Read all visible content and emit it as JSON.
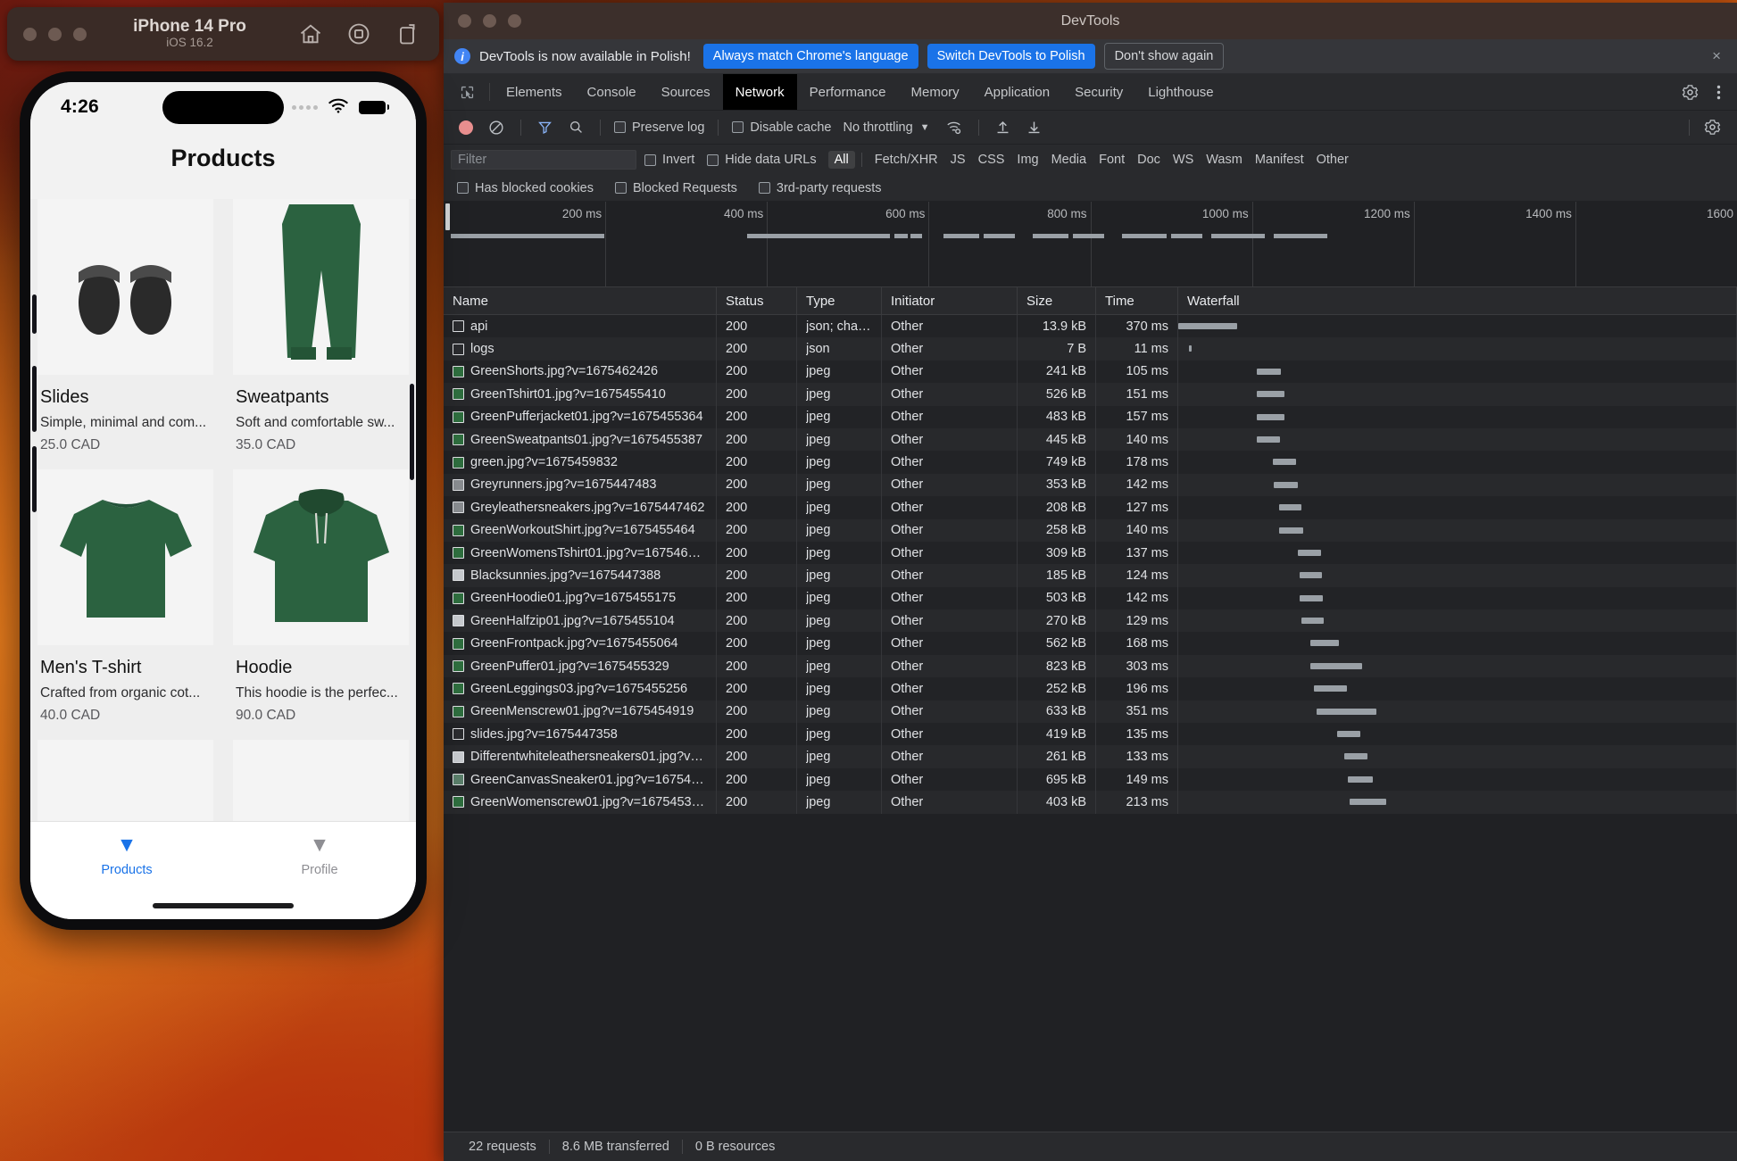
{
  "simulator": {
    "device_name": "iPhone 14 Pro",
    "os_version": "iOS 16.2",
    "icons": [
      "home-icon",
      "record-icon",
      "screenshot-icon"
    ]
  },
  "phone": {
    "status": {
      "time": "4:26",
      "wifi": "wifi-icon",
      "battery": "battery-icon"
    },
    "app_title": "Products",
    "products": [
      {
        "title": "Slides",
        "desc": "Simple, minimal and com...",
        "price": "25.0 CAD",
        "image": "slides-image"
      },
      {
        "title": "Sweatpants",
        "desc": "Soft and comfortable sw...",
        "price": "35.0 CAD",
        "image": "sweatpants-image"
      },
      {
        "title": "Men's T-shirt",
        "desc": "Crafted from organic cot...",
        "price": "40.0 CAD",
        "image": "tshirt-image"
      },
      {
        "title": "Hoodie",
        "desc": "This hoodie is the perfec...",
        "price": "90.0 CAD",
        "image": "hoodie-image"
      }
    ],
    "tabs": [
      {
        "label": "Products",
        "icon": "products-icon",
        "active": true
      },
      {
        "label": "Profile",
        "icon": "profile-icon",
        "active": false
      }
    ]
  },
  "devtools": {
    "window_title": "DevTools",
    "notice": {
      "icon": "info-icon",
      "message": "DevTools is now available in Polish!",
      "primary_buttons": [
        "Always match Chrome's language",
        "Switch DevTools to Polish"
      ],
      "ghost_button": "Don't show again",
      "close": "×"
    },
    "panels": [
      {
        "label": "Elements",
        "selected": false
      },
      {
        "label": "Console",
        "selected": false
      },
      {
        "label": "Sources",
        "selected": false
      },
      {
        "label": "Network",
        "selected": true
      },
      {
        "label": "Performance",
        "selected": false
      },
      {
        "label": "Memory",
        "selected": false
      },
      {
        "label": "Application",
        "selected": false
      },
      {
        "label": "Security",
        "selected": false
      },
      {
        "label": "Lighthouse",
        "selected": false
      }
    ],
    "toolbar": {
      "record_title": "record-button",
      "clear_title": "clear-button",
      "filter_title": "filter-button",
      "search_title": "search-button",
      "preserve_log": "Preserve log",
      "disable_cache": "Disable cache",
      "throttling": "No throttling",
      "import_title": "import-har-button",
      "export_title": "export-har-button",
      "settings_title": "network-settings-button"
    },
    "filters": {
      "placeholder": "Filter",
      "invert": "Invert",
      "hide_data_urls": "Hide data URLs",
      "types": [
        "All",
        "Fetch/XHR",
        "JS",
        "CSS",
        "Img",
        "Media",
        "Font",
        "Doc",
        "WS",
        "Wasm",
        "Manifest",
        "Other"
      ],
      "active_type": "All",
      "has_blocked_cookies": "Has blocked cookies",
      "blocked_requests": "Blocked Requests",
      "third_party_requests": "3rd-party requests"
    },
    "overview_ticks": [
      "200 ms",
      "400 ms",
      "600 ms",
      "800 ms",
      "1000 ms",
      "1200 ms",
      "1400 ms",
      "1600"
    ],
    "columns": [
      "Name",
      "Status",
      "Type",
      "Initiator",
      "Size",
      "Time",
      "Waterfall"
    ],
    "requests": [
      {
        "name": "api",
        "status": "200",
        "type": "json; char…",
        "initiator": "Other",
        "size": "13.9 kB",
        "time": "370 ms",
        "icon_color": "#2b2c2f",
        "wf_start": 0,
        "wf_width": 66
      },
      {
        "name": "logs",
        "status": "200",
        "type": "json",
        "initiator": "Other",
        "size": "7 B",
        "time": "11 ms",
        "icon_color": "#2b2c2f",
        "wf_start": 12,
        "wf_width": 3
      },
      {
        "name": "GreenShorts.jpg?v=1675462426",
        "status": "200",
        "type": "jpeg",
        "initiator": "Other",
        "size": "241 kB",
        "time": "105 ms",
        "icon_color": "#2f6f3f",
        "wf_start": 88,
        "wf_width": 27
      },
      {
        "name": "GreenTshirt01.jpg?v=1675455410",
        "status": "200",
        "type": "jpeg",
        "initiator": "Other",
        "size": "526 kB",
        "time": "151 ms",
        "icon_color": "#2f6f3f",
        "wf_start": 88,
        "wf_width": 31
      },
      {
        "name": "GreenPufferjacket01.jpg?v=1675455364",
        "status": "200",
        "type": "jpeg",
        "initiator": "Other",
        "size": "483 kB",
        "time": "157 ms",
        "icon_color": "#2f6f3f",
        "wf_start": 88,
        "wf_width": 31
      },
      {
        "name": "GreenSweatpants01.jpg?v=1675455387",
        "status": "200",
        "type": "jpeg",
        "initiator": "Other",
        "size": "445 kB",
        "time": "140 ms",
        "icon_color": "#2f6f3f",
        "wf_start": 88,
        "wf_width": 26
      },
      {
        "name": "green.jpg?v=1675459832",
        "status": "200",
        "type": "jpeg",
        "initiator": "Other",
        "size": "749 kB",
        "time": "178 ms",
        "icon_color": "#2f6f3f",
        "wf_start": 106,
        "wf_width": 26
      },
      {
        "name": "Greyrunners.jpg?v=1675447483",
        "status": "200",
        "type": "jpeg",
        "initiator": "Other",
        "size": "353 kB",
        "time": "142 ms",
        "icon_color": "#8a8d91",
        "wf_start": 107,
        "wf_width": 27
      },
      {
        "name": "Greyleathersneakers.jpg?v=1675447462",
        "status": "200",
        "type": "jpeg",
        "initiator": "Other",
        "size": "208 kB",
        "time": "127 ms",
        "icon_color": "#8a8d91",
        "wf_start": 113,
        "wf_width": 25
      },
      {
        "name": "GreenWorkoutShirt.jpg?v=1675455464",
        "status": "200",
        "type": "jpeg",
        "initiator": "Other",
        "size": "258 kB",
        "time": "140 ms",
        "icon_color": "#2f6f3f",
        "wf_start": 113,
        "wf_width": 27
      },
      {
        "name": "GreenWomensTshirt01.jpg?v=1675463…",
        "status": "200",
        "type": "jpeg",
        "initiator": "Other",
        "size": "309 kB",
        "time": "137 ms",
        "icon_color": "#2f6f3f",
        "wf_start": 134,
        "wf_width": 26
      },
      {
        "name": "Blacksunnies.jpg?v=1675447388",
        "status": "200",
        "type": "jpeg",
        "initiator": "Other",
        "size": "185 kB",
        "time": "124 ms",
        "icon_color": "#c9ccd0",
        "wf_start": 136,
        "wf_width": 25
      },
      {
        "name": "GreenHoodie01.jpg?v=1675455175",
        "status": "200",
        "type": "jpeg",
        "initiator": "Other",
        "size": "503 kB",
        "time": "142 ms",
        "icon_color": "#2f6f3f",
        "wf_start": 136,
        "wf_width": 26
      },
      {
        "name": "GreenHalfzip01.jpg?v=1675455104",
        "status": "200",
        "type": "jpeg",
        "initiator": "Other",
        "size": "270 kB",
        "time": "129 ms",
        "icon_color": "#c9ccd0",
        "wf_start": 138,
        "wf_width": 25
      },
      {
        "name": "GreenFrontpack.jpg?v=1675455064",
        "status": "200",
        "type": "jpeg",
        "initiator": "Other",
        "size": "562 kB",
        "time": "168 ms",
        "icon_color": "#2f6f3f",
        "wf_start": 148,
        "wf_width": 32
      },
      {
        "name": "GreenPuffer01.jpg?v=1675455329",
        "status": "200",
        "type": "jpeg",
        "initiator": "Other",
        "size": "823 kB",
        "time": "303 ms",
        "icon_color": "#2f6f3f",
        "wf_start": 148,
        "wf_width": 58
      },
      {
        "name": "GreenLeggings03.jpg?v=1675455256",
        "status": "200",
        "type": "jpeg",
        "initiator": "Other",
        "size": "252 kB",
        "time": "196 ms",
        "icon_color": "#2f6f3f",
        "wf_start": 152,
        "wf_width": 37
      },
      {
        "name": "GreenMenscrew01.jpg?v=1675454919",
        "status": "200",
        "type": "jpeg",
        "initiator": "Other",
        "size": "633 kB",
        "time": "351 ms",
        "icon_color": "#2f6f3f",
        "wf_start": 155,
        "wf_width": 67
      },
      {
        "name": "slides.jpg?v=1675447358",
        "status": "200",
        "type": "jpeg",
        "initiator": "Other",
        "size": "419 kB",
        "time": "135 ms",
        "icon_color": "#2b2c2f",
        "wf_start": 178,
        "wf_width": 26
      },
      {
        "name": "Differentwhiteleathersneakers01.jpg?v…",
        "status": "200",
        "type": "jpeg",
        "initiator": "Other",
        "size": "261 kB",
        "time": "133 ms",
        "icon_color": "#c9ccd0",
        "wf_start": 186,
        "wf_width": 26
      },
      {
        "name": "GreenCanvasSneaker01.jpg?v=167545…",
        "status": "200",
        "type": "jpeg",
        "initiator": "Other",
        "size": "695 kB",
        "time": "149 ms",
        "icon_color": "#5b7f6b",
        "wf_start": 190,
        "wf_width": 28
      },
      {
        "name": "GreenWomenscrew01.jpg?v=1675453…",
        "status": "200",
        "type": "jpeg",
        "initiator": "Other",
        "size": "403 kB",
        "time": "213 ms",
        "icon_color": "#2f6f3f",
        "wf_start": 192,
        "wf_width": 41
      }
    ],
    "status_bar": {
      "requests": "22 requests",
      "transferred": "8.6 MB transferred",
      "resources": "0 B resources"
    }
  }
}
